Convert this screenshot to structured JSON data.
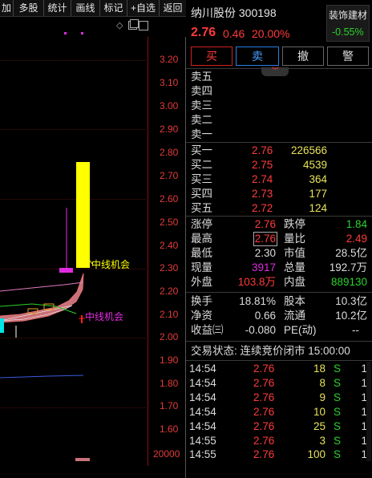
{
  "toolbar": {
    "items": [
      "加",
      "多股",
      "统计",
      "画线",
      "标记",
      "+自选",
      "返回"
    ]
  },
  "chart": {
    "price_labels": [
      "3.20",
      "3.10",
      "3.00",
      "2.90",
      "2.80",
      "2.70",
      "2.60",
      "2.50",
      "2.40",
      "2.30",
      "2.20",
      "2.10",
      "2.00",
      "1.90",
      "1.80",
      "1.70",
      "1.60"
    ],
    "volume_label": "20000",
    "annotation_1": "中线机会",
    "annotation_2": "中线机会",
    "diamond_icon": "◇",
    "colors": {
      "up": "#ff3b3b",
      "yellow": "#ffff00",
      "magenta": "#e02be0",
      "cyan": "#00ffff"
    }
  },
  "stock": {
    "name": "纳川股份",
    "code": "300198",
    "price": "2.76",
    "change": "0.46",
    "change_pct": "20.00%",
    "sector_name": "装饰建材",
    "sector_pct": "-0.55%"
  },
  "actions": {
    "buy": "买",
    "sell": "卖",
    "cancel": "撤",
    "alert": "警"
  },
  "sell_orders": [
    {
      "label": "卖五"
    },
    {
      "label": "卖四"
    },
    {
      "label": "卖三"
    },
    {
      "label": "卖二"
    },
    {
      "label": "卖一"
    }
  ],
  "buy_orders": [
    {
      "label": "买一",
      "price": "2.76",
      "vol": "226566"
    },
    {
      "label": "买二",
      "price": "2.75",
      "vol": "4539"
    },
    {
      "label": "买三",
      "price": "2.74",
      "vol": "364"
    },
    {
      "label": "买四",
      "price": "2.73",
      "vol": "177"
    },
    {
      "label": "买五",
      "price": "2.72",
      "vol": "124"
    }
  ],
  "stats": {
    "limit_up_label": "涨停",
    "limit_up": "2.76",
    "limit_down_label": "跌停",
    "limit_down": "1.84",
    "high_label": "最高",
    "high": "2.76",
    "vol_ratio_label": "量比",
    "vol_ratio": "2.49",
    "low_label": "最低",
    "low": "2.30",
    "mcap_label": "市值",
    "mcap": "28.5亿",
    "cur_vol_label": "现量",
    "cur_vol": "3917",
    "total_vol_label": "总量",
    "total_vol": "192.7万",
    "outer_label": "外盘",
    "outer": "103.8万",
    "inner_label": "内盘",
    "inner": "889130",
    "turnover_label": "换手",
    "turnover": "18.81%",
    "shares_label": "股本",
    "shares": "10.3亿",
    "nav_label": "净资",
    "nav": "0.66",
    "float_label": "流通",
    "float": "10.2亿",
    "eps_label": "收益㈢",
    "eps": "-0.080",
    "pe_label": "PE(动)",
    "pe": "--"
  },
  "status": "交易状态: 连续竞价闭市 15:00:00",
  "ticks": [
    {
      "time": "14:54",
      "price": "2.76",
      "vol": "18",
      "side": "S",
      "n": "1"
    },
    {
      "time": "14:54",
      "price": "2.76",
      "vol": "8",
      "side": "S",
      "n": "1"
    },
    {
      "time": "14:54",
      "price": "2.76",
      "vol": "9",
      "side": "S",
      "n": "1"
    },
    {
      "time": "14:54",
      "price": "2.76",
      "vol": "10",
      "side": "S",
      "n": "1"
    },
    {
      "time": "14:54",
      "price": "2.76",
      "vol": "25",
      "side": "S",
      "n": "1"
    },
    {
      "time": "14:55",
      "price": "2.76",
      "vol": "3",
      "side": "S",
      "n": "1"
    },
    {
      "time": "14:55",
      "price": "2.76",
      "vol": "100",
      "side": "S",
      "n": "1"
    }
  ]
}
